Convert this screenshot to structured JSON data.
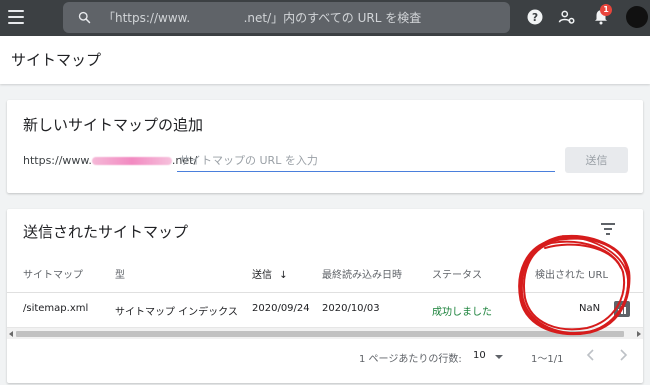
{
  "topbar": {
    "search_placeholder": "「https://www.              .net/」内のすべての URL を検査",
    "notification_count": "1",
    "icons": [
      "menu-icon",
      "search-icon",
      "help-icon",
      "user-settings-icon",
      "bell-icon",
      "avatar"
    ]
  },
  "page": {
    "title": "サイトマップ"
  },
  "add_card": {
    "title": "新しいサイトマップの追加",
    "url_prefix_start": "https://www.",
    "url_prefix_end": ".net/",
    "input_placeholder": "サイトマップの URL を入力",
    "submit_label": "送信"
  },
  "submitted_card": {
    "title": "送信されたサイトマップ",
    "columns": [
      "サイトマップ",
      "型",
      "送信",
      "最終読み込み日時",
      "ステータス",
      "検出された URL"
    ],
    "sorted_indicator": "↓",
    "rows": [
      {
        "sitemap": "/sitemap.xml",
        "type": "サイトマップ インデックス",
        "submitted": "2020/09/24",
        "last_read": "2020/10/03",
        "status": "成功しました",
        "discovered_urls": "NaN"
      }
    ],
    "pagination": {
      "rows_per_page_label": "1 ページあたりの行数:",
      "rows_per_page": "10",
      "range": "1〜1/1"
    }
  },
  "colors": {
    "topbar": "#3c4043",
    "accent_blue": "#4a7fdc",
    "success_green": "#188038",
    "annotation_red": "#d61c1c"
  }
}
